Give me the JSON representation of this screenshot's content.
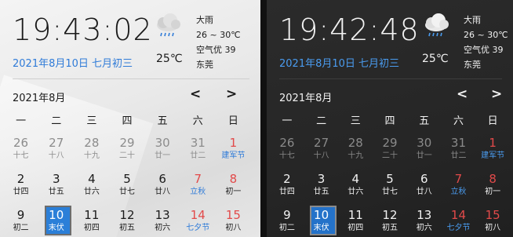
{
  "weekday_headers": [
    "一",
    "二",
    "三",
    "四",
    "五",
    "六",
    "日"
  ],
  "light": {
    "time": "19:43:02",
    "date": "2021年8月10日 七月初三",
    "temp": "25℃",
    "weather": {
      "cond": "大雨",
      "range": "26 ~ 30℃",
      "aqi": "空气优 39",
      "city": "东莞"
    },
    "month": "2021年8月",
    "prev": "<",
    "next": ">"
  },
  "dark": {
    "time": "19:42:48",
    "date": "2021年8月10日 七月初三",
    "temp": "25℃",
    "weather": {
      "cond": "大雨",
      "range": "26 ~ 30℃",
      "aqi": "空气优 39",
      "city": "东莞"
    },
    "month": "2021年8月",
    "prev": "<",
    "next": ">"
  },
  "weeks": [
    [
      {
        "n": "26",
        "s": "十七",
        "style": "muted"
      },
      {
        "n": "27",
        "s": "十八",
        "style": "muted"
      },
      {
        "n": "28",
        "s": "十九",
        "style": "muted"
      },
      {
        "n": "29",
        "s": "二十",
        "style": "muted"
      },
      {
        "n": "30",
        "s": "廿一",
        "style": "muted"
      },
      {
        "n": "31",
        "s": "廿二",
        "style": "muted"
      },
      {
        "n": "1",
        "s": "建军节",
        "style": "red blue-sub"
      }
    ],
    [
      {
        "n": "2",
        "s": "廿四",
        "style": ""
      },
      {
        "n": "3",
        "s": "廿五",
        "style": ""
      },
      {
        "n": "4",
        "s": "廿六",
        "style": ""
      },
      {
        "n": "5",
        "s": "廿七",
        "style": ""
      },
      {
        "n": "6",
        "s": "廿八",
        "style": ""
      },
      {
        "n": "7",
        "s": "立秋",
        "style": "red blue-sub"
      },
      {
        "n": "8",
        "s": "初一",
        "style": "red"
      }
    ],
    [
      {
        "n": "9",
        "s": "初二",
        "style": ""
      },
      {
        "n": "10",
        "s": "末伏",
        "style": "sel"
      },
      {
        "n": "11",
        "s": "初四",
        "style": ""
      },
      {
        "n": "12",
        "s": "初五",
        "style": ""
      },
      {
        "n": "13",
        "s": "初六",
        "style": ""
      },
      {
        "n": "14",
        "s": "七夕节",
        "style": "red blue-sub"
      },
      {
        "n": "15",
        "s": "初八",
        "style": "red"
      }
    ]
  ]
}
